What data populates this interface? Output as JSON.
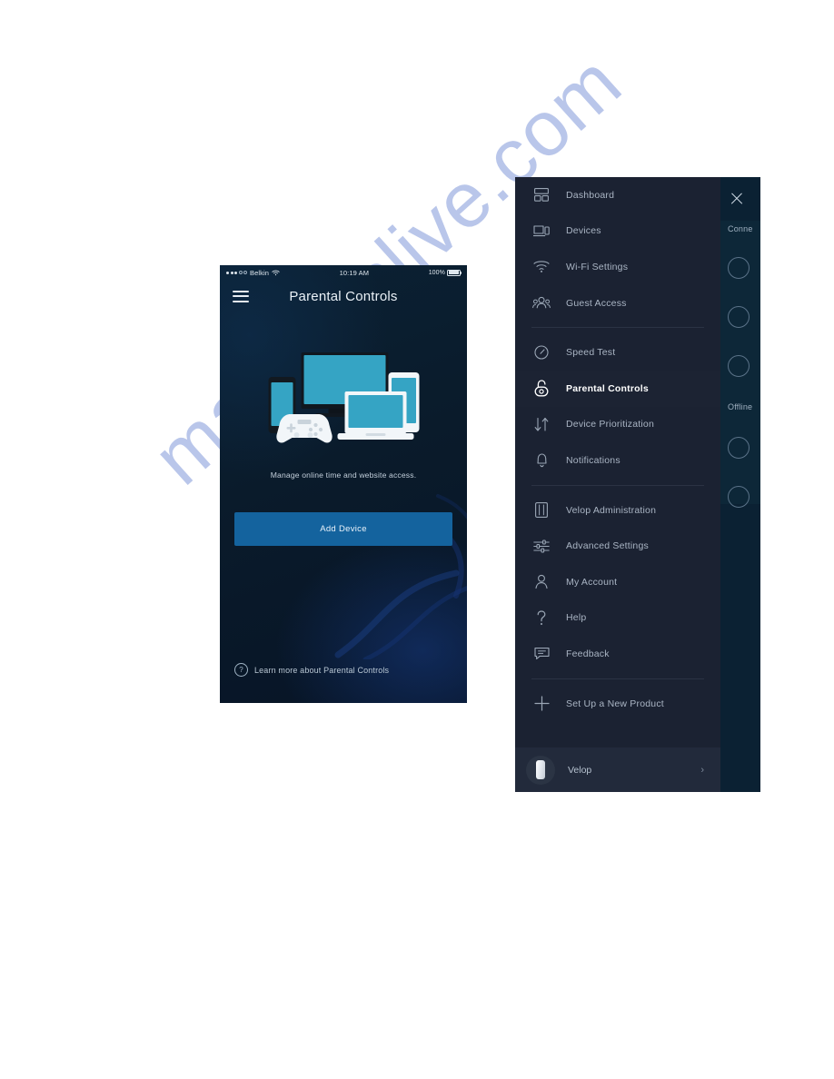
{
  "watermark": {
    "text": "manualslive.com",
    "color": "#4869c8"
  },
  "phone": {
    "status_bar": {
      "carrier": "Belkin",
      "time": "10:19 AM",
      "battery_percent": "100%",
      "signal_icon": "signal-dots-icon",
      "wifi_icon": "wifi-icon",
      "battery_icon": "battery-full-icon"
    },
    "header": {
      "menu_icon": "hamburger-menu-icon",
      "title": "Parental Controls"
    },
    "illustration": {
      "name": "connected-devices-illustration",
      "items": [
        "tv-monitor",
        "smartphone",
        "game-controller",
        "laptop",
        "tablet"
      ],
      "accent_color": "#35a4c4",
      "white_color": "#f2f6f9"
    },
    "subtitle": "Manage online time and website access.",
    "primary_button": {
      "label": "Add Device",
      "color": "#14639e"
    },
    "learn_more": {
      "icon": "question-circle-icon",
      "label": "Learn more about Parental Controls"
    },
    "background_color": "#0a1a2a"
  },
  "menu": {
    "background_color": "#1b2232",
    "active_item": "Parental Controls",
    "groups": [
      {
        "items": [
          {
            "label": "Dashboard",
            "icon": "dashboard-grid-icon",
            "active": false
          },
          {
            "label": "Devices",
            "icon": "devices-icon",
            "active": false
          },
          {
            "label": "Wi-Fi Settings",
            "icon": "wifi-icon",
            "active": false
          },
          {
            "label": "Guest Access",
            "icon": "guest-users-icon",
            "active": false
          }
        ]
      },
      {
        "items": [
          {
            "label": "Speed Test",
            "icon": "speedometer-icon",
            "active": false
          },
          {
            "label": "Parental Controls",
            "icon": "padlock-open-icon",
            "active": true
          },
          {
            "label": "Device Prioritization",
            "icon": "up-down-arrows-icon",
            "active": false
          },
          {
            "label": "Notifications",
            "icon": "bell-icon",
            "active": false
          }
        ]
      },
      {
        "items": [
          {
            "label": "Velop Administration",
            "icon": "velop-node-icon",
            "active": false
          },
          {
            "label": "Advanced Settings",
            "icon": "sliders-icon",
            "active": false
          },
          {
            "label": "My Account",
            "icon": "person-icon",
            "active": false
          },
          {
            "label": "Help",
            "icon": "question-mark-icon",
            "active": false
          },
          {
            "label": "Feedback",
            "icon": "speech-bubble-icon",
            "active": false
          }
        ]
      },
      {
        "items": [
          {
            "label": "Set Up a New Product",
            "icon": "plus-icon",
            "active": false
          }
        ]
      }
    ],
    "footer": {
      "avatar_icon": "velop-node-avatar",
      "label": "Velop",
      "chevron_icon": "chevron-right-icon"
    }
  },
  "side_panel": {
    "background_color": "#0b2133",
    "close_icon": "close-x-icon",
    "groups": [
      {
        "title": "Conne",
        "circle_count": 3
      },
      {
        "title": "Offline",
        "circle_count": 2
      }
    ]
  }
}
